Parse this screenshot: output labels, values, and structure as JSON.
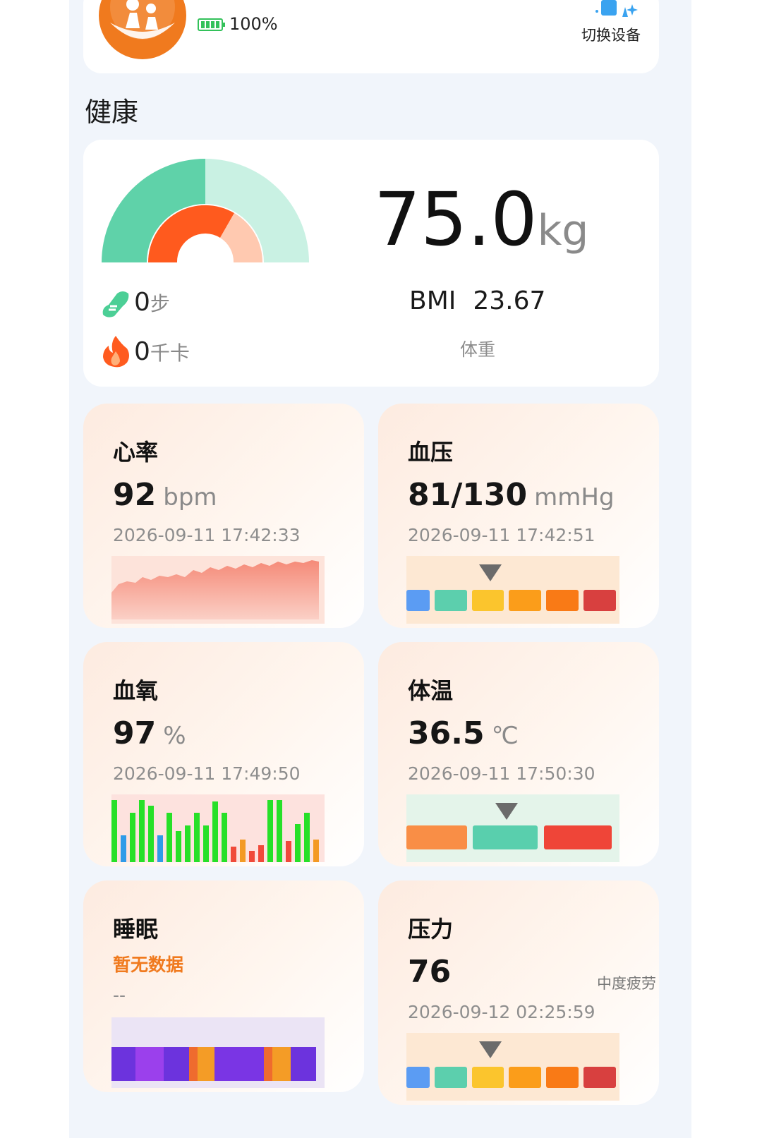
{
  "device": {
    "battery": "100%",
    "switch_device_label": "切换设备"
  },
  "section": {
    "health_title": "健康"
  },
  "summary": {
    "weight_value": "75.0",
    "weight_unit": "kg",
    "bmi_label": "BMI",
    "bmi_value": "23.67",
    "weight_caption": "体重",
    "steps_value": "0",
    "steps_unit": "步",
    "calories_value": "0",
    "calories_unit": "千卡"
  },
  "metrics": {
    "heart_rate": {
      "title": "心率",
      "value": "92",
      "unit": "bpm",
      "time": "2026-09-11 17:42:33"
    },
    "blood_pressure": {
      "title": "血压",
      "value": "81/130",
      "unit": "mmHg",
      "time": "2026-09-11 17:42:51"
    },
    "blood_oxygen": {
      "title": "血氧",
      "value": "97",
      "unit": "%",
      "time": "2026-09-11 17:49:50"
    },
    "temperature": {
      "title": "体温",
      "value": "36.5",
      "unit": "℃",
      "time": "2026-09-11 17:50:30"
    },
    "sleep": {
      "title": "睡眠",
      "status": "暂无数据",
      "time": "--"
    },
    "stress": {
      "title": "压力",
      "value": "76",
      "level": "中度疲劳",
      "time": "2026-09-12 02:25:59"
    }
  },
  "colors": {
    "accent_orange": "#f07a1e",
    "gauge_green": "#5fd2a9",
    "gauge_light_green": "#c9f1e3",
    "gauge_orange": "#ff5a1e",
    "gauge_peach": "#ffc9b0",
    "bp_scale": [
      "#5b9cf3",
      "#5ccfad",
      "#fbc52d",
      "#fb9d1a",
      "#f97a16",
      "#d8403f"
    ],
    "temp_scale": [
      "#f98e46",
      "#59cfad",
      "#ef4538"
    ],
    "sleep_deep": "#6c33dd",
    "sleep_light": "#9b40ec",
    "sleep_awake": "#f49c26",
    "spo2_green": "#27e028",
    "spo2_blue": "#2f9be8",
    "spo2_orange": "#f39a24",
    "spo2_red": "#f04a3a"
  },
  "icons": {
    "battery": "battery-full-icon",
    "switch": "switch-device-icon",
    "steps": "shoe-icon",
    "calories": "flame-icon",
    "avatar": "family-care-logo"
  }
}
